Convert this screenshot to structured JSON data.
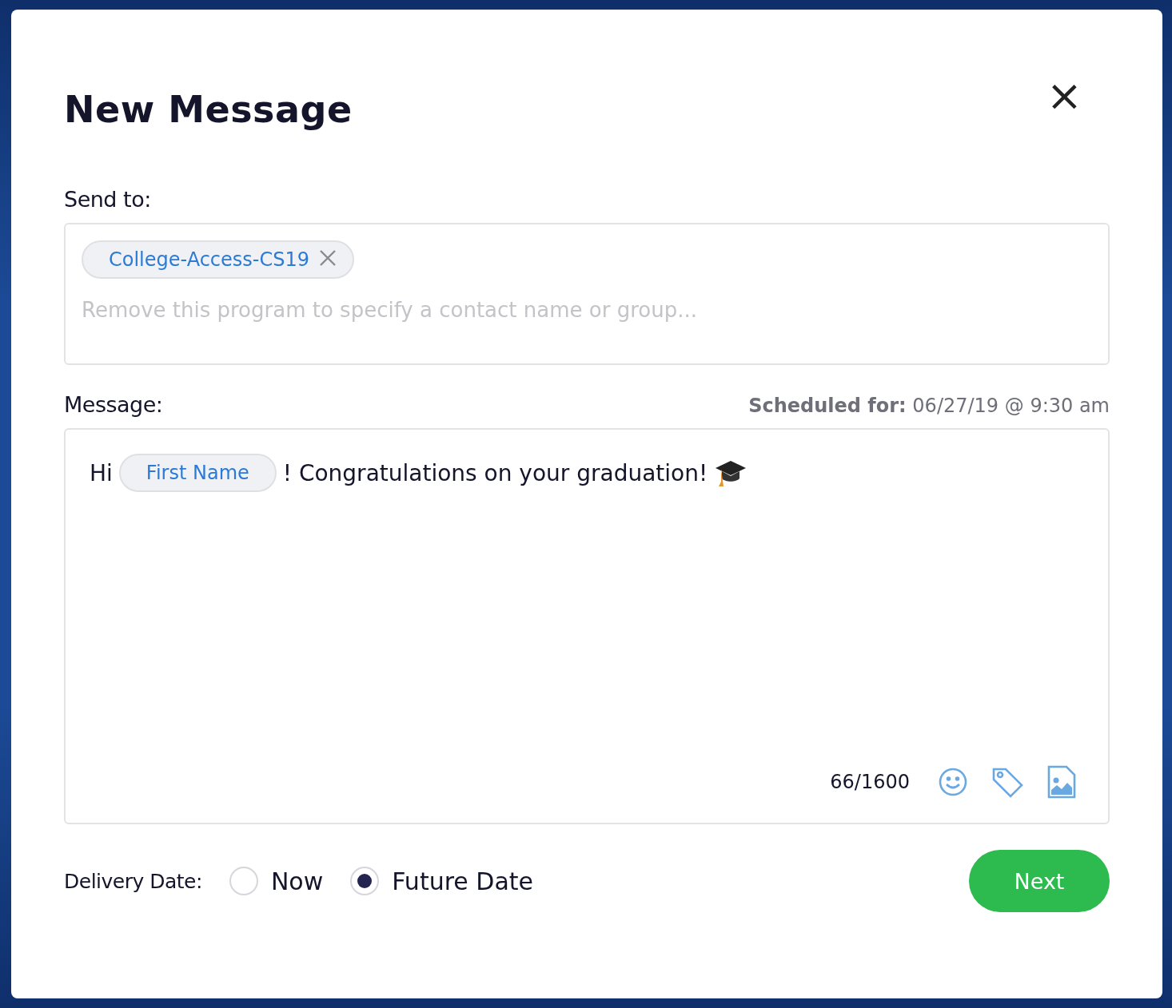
{
  "dialog": {
    "title": "New Message",
    "close": "×"
  },
  "send_to": {
    "label": "Send to:",
    "chips": [
      {
        "text": "College-Access-CS19"
      }
    ],
    "placeholder": "Remove this program to specify a contact name or group..."
  },
  "message": {
    "label": "Message:",
    "scheduled_label": "Scheduled for:",
    "scheduled_value": "06/27/19 @ 9:30 am",
    "body": [
      {
        "kind": "text",
        "text": "Hi"
      },
      {
        "kind": "tag",
        "text": "First Name"
      },
      {
        "kind": "text",
        "text": "! Congratulations on your graduation!"
      },
      {
        "kind": "emoji"
      }
    ],
    "counter": "66/1600"
  },
  "delivery": {
    "label": "Delivery Date:",
    "options": [
      {
        "label": "Now",
        "selected": false
      },
      {
        "label": "Future Date",
        "selected": true
      }
    ]
  },
  "next_button": "Next"
}
